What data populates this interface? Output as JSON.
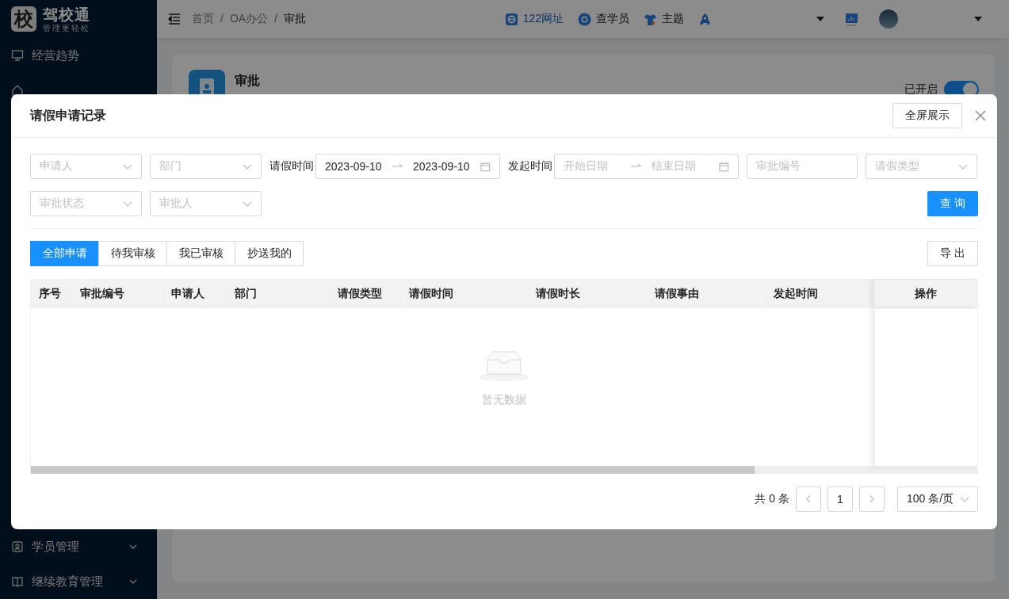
{
  "sidebar": {
    "logo": {
      "mark": "校",
      "name": "驾校通",
      "slogan": "管理更轻松"
    },
    "items": [
      {
        "label": "经营趋势",
        "kind": "monitor",
        "expandable": false
      },
      {
        "kind": "home"
      },
      {
        "label": "学员管理",
        "kind": "person",
        "expandable": true
      },
      {
        "label": "继续教育管理",
        "kind": "book",
        "expandable": true
      }
    ]
  },
  "header": {
    "breadcrumb": [
      "首页",
      "OA办公",
      "审批"
    ],
    "breadcrumb_separator": "/",
    "tools": [
      {
        "kind": "ie",
        "label": "122网址"
      },
      {
        "kind": "search",
        "label": "查学员"
      },
      {
        "kind": "shirt",
        "label": "主题"
      },
      {
        "kind": "rocket"
      }
    ]
  },
  "page_card": {
    "title": "审批",
    "switch": {
      "label": "已开启",
      "on": true
    }
  },
  "modal": {
    "title": "请假申请记录",
    "fullscreen_button": "全屏展示",
    "filter_rows": [
      {
        "filters": [
          {
            "kind": "select",
            "placeholder": "申请人"
          },
          {
            "kind": "select",
            "placeholder": "部门"
          },
          {
            "kind": "date_range",
            "label": "请假时间",
            "start": {
              "value": "2023-09-10"
            },
            "end": {
              "value": "2023-09-10"
            }
          },
          {
            "kind": "date_range",
            "label": "发起时间",
            "start": {
              "placeholder": "开始日期"
            },
            "end": {
              "placeholder": "结束日期"
            }
          },
          {
            "kind": "input",
            "placeholder": "审批编号"
          },
          {
            "kind": "select",
            "placeholder": "请假类型"
          }
        ]
      },
      {
        "filters": [
          {
            "kind": "select",
            "placeholder": "审批状态"
          },
          {
            "kind": "select",
            "placeholder": "审批人"
          }
        ]
      }
    ],
    "query_button": "查 询",
    "tabs": [
      {
        "label": "全部申请",
        "selected": true
      },
      {
        "label": "待我审核",
        "selected": false
      },
      {
        "label": "我已审核",
        "selected": false
      },
      {
        "label": "抄送我的",
        "selected": false
      }
    ],
    "export_button": "导 出",
    "table": {
      "columns": [
        "序号",
        "审批编号",
        "申请人",
        "部门",
        "请假类型",
        "请假时间",
        "请假时长",
        "请假事由",
        "发起时间"
      ],
      "fixed_column": "操作",
      "empty_text": "暂无数据"
    },
    "pagination": {
      "total": "共 0 条",
      "page": "1",
      "page_size": "100 条/页"
    }
  }
}
